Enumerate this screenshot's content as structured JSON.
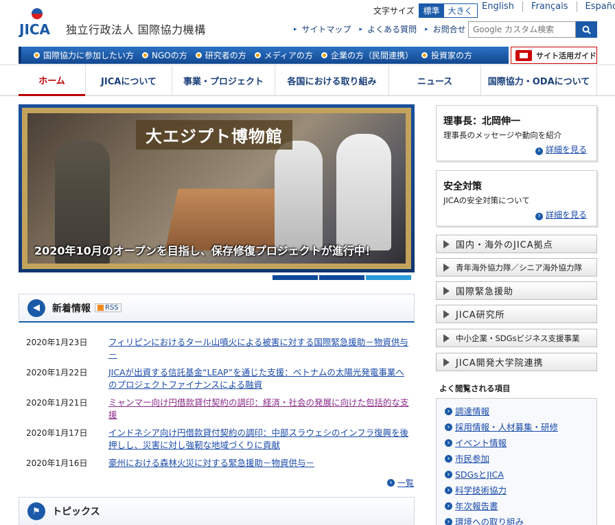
{
  "header": {
    "logo_text": "JICA",
    "org_name": "独立行政法人 国際協力機構",
    "font_size_label": "文字サイズ",
    "font_size_options": [
      "標準",
      "大きく"
    ],
    "languages": [
      "English",
      "Français",
      "Español"
    ],
    "utility_links": [
      "サイトマップ",
      "よくある質問",
      "お問合せ"
    ],
    "search_placeholder": "Google カスタム検索"
  },
  "audience_nav": [
    "国際協力に参加したい方",
    "NGOの方",
    "研究者の方",
    "メディアの方",
    "企業の方（民間連携）",
    "投資家の方"
  ],
  "site_guide": "サイト活用ガイド",
  "main_nav": [
    "ホーム",
    "JICAについて",
    "事業・プロジェクト",
    "各国における取り組み",
    "ニュース",
    "国際協力・ODAについて"
  ],
  "hero": {
    "title": "大エジプト博物館",
    "caption": "2020年10月のオープンを目指し、保存修復プロジェクトが進行中！"
  },
  "news": {
    "heading": "新着情報",
    "rss": "RSS",
    "items": [
      {
        "date": "2020年1月23日",
        "title": "フィリピンにおけるタール山噴火による被害に対する国際緊急援助－物資供与－"
      },
      {
        "date": "2020年1月22日",
        "title": "JICAが出資する信託基金“LEAP”を通じた支援：ベトナムの太陽光発電事業へのプロジェクトファイナンスによる融資"
      },
      {
        "date": "2020年1月21日",
        "title": "ミャンマー向け円借款貸付契約の調印：経済・社会の発展に向けた包括的な支援"
      },
      {
        "date": "2020年1月17日",
        "title": "インドネシア向け円借款貸付契約の調印：中部スラウェシのインフラ復興を後押しし、災害に対し強靭な地域づくりに貢献"
      },
      {
        "date": "2020年1月16日",
        "title": "豪州における森林火災に対する緊急援助－物資供与－"
      }
    ],
    "more_label": "一覧"
  },
  "topics": {
    "heading": "トピックス"
  },
  "president": {
    "title": "理事長：北岡伸一",
    "desc": "理事長のメッセージや動向を紹介",
    "link": "詳細を見る"
  },
  "safety": {
    "title": "安全対策",
    "desc": "JICAの安全対策について",
    "link": "詳細を見る"
  },
  "banners": [
    "国内・海外のJICA拠点",
    "青年海外協力隊／シニア海外協力隊",
    "国際緊急援助",
    "JICA研究所",
    "中小企業・SDGsビジネス支援事業",
    "JICA開発大学院連携"
  ],
  "frequent": {
    "title": "よく閲覧される項目",
    "items": [
      "調達情報",
      "採用情報・人材募集・研修",
      "イベント情報",
      "市民参加",
      "SDGsとJICA",
      "科学技術協力",
      "年次報告書",
      "環境への取り組み"
    ]
  }
}
